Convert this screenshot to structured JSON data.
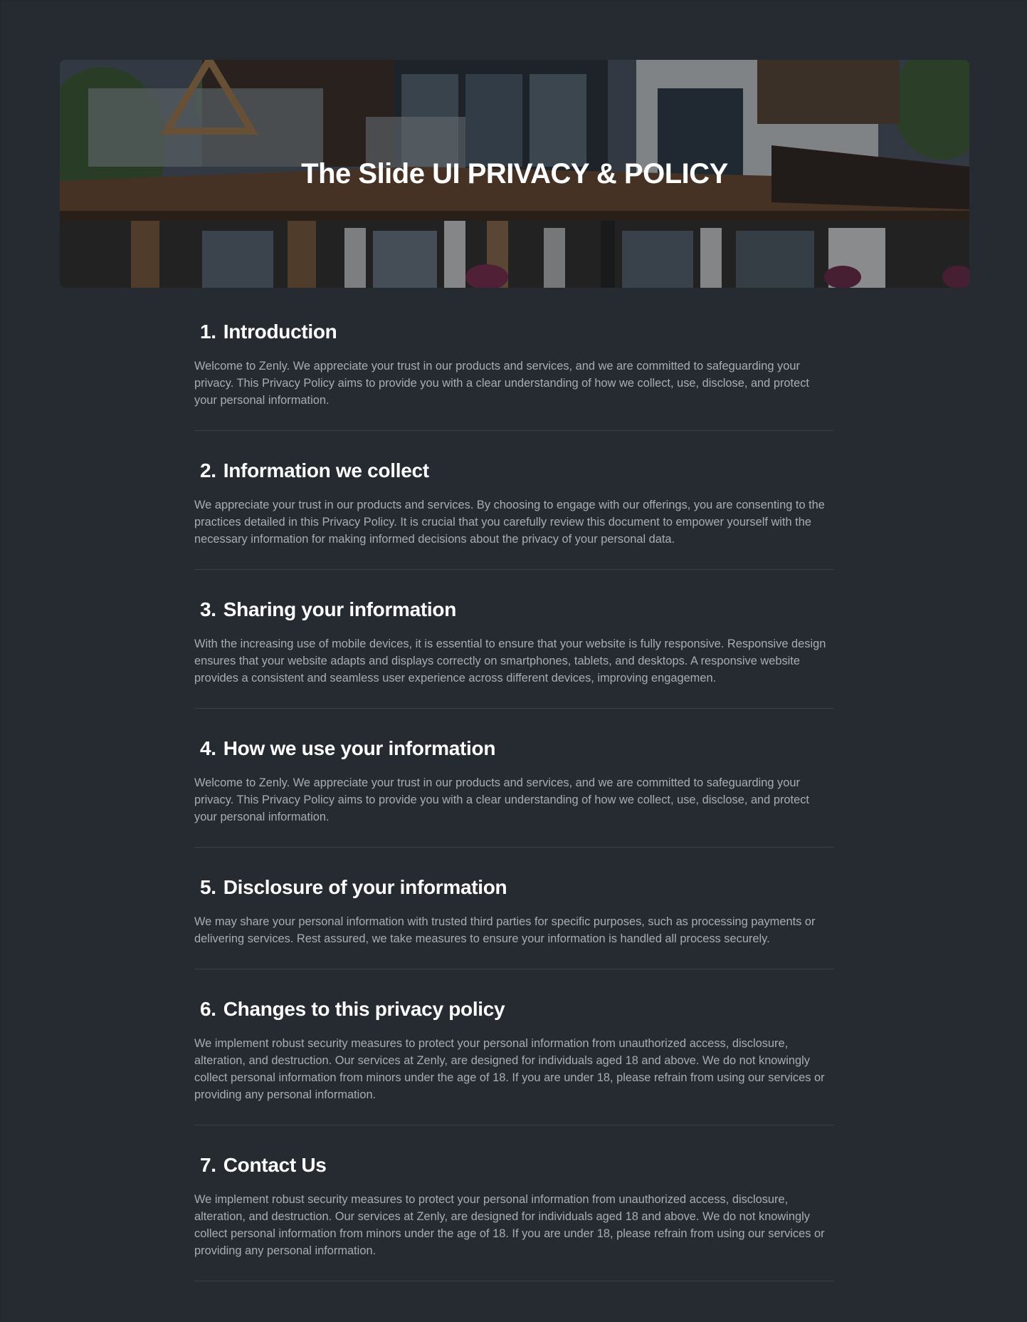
{
  "hero": {
    "title": "The Slide UI PRIVACY & POLICY"
  },
  "colors": {
    "page_background": "#252b30",
    "heading": "#ffffff",
    "body_text": "#a7adb3",
    "divider": "#3a4046"
  },
  "sections": [
    {
      "number": "1.",
      "title": "Introduction",
      "body": "Welcome to Zenly. We appreciate your trust in our products and services, and we are committed to safeguarding your privacy. This Privacy Policy aims to provide you with a clear understanding of how we collect, use, disclose, and protect your personal information."
    },
    {
      "number": "2.",
      "title": "Information we collect",
      "body": "We appreciate your trust in our products and services. By choosing to engage with our offerings, you are consenting to the practices detailed in this Privacy Policy. It is crucial that you carefully review this document to empower yourself with the necessary information for making informed decisions about the privacy of your personal data."
    },
    {
      "number": "3.",
      "title": "Sharing your information",
      "body": "With the increasing use of mobile devices, it is essential to ensure that your website is fully responsive. Responsive design ensures that your website adapts and displays correctly on smartphones, tablets, and desktops. A responsive website provides a consistent and seamless user experience across different devices, improving engagemen."
    },
    {
      "number": "4.",
      "title": "How we use your information",
      "body": "Welcome to Zenly. We appreciate your trust in our products and services, and we are committed to safeguarding your privacy. This Privacy Policy aims to provide you with a clear understanding of how we collect, use, disclose, and protect your personal information."
    },
    {
      "number": "5.",
      "title": "Disclosure of your information",
      "body": "We may share your personal information with trusted third parties for specific purposes, such as processing payments or delivering services. Rest assured, we take measures to ensure your information is handled all process securely."
    },
    {
      "number": "6.",
      "title": "Changes to this privacy policy",
      "body": "We implement robust security measures to protect your personal information from unauthorized access, disclosure, alteration, and destruction. Our services at Zenly, are designed for individuals aged 18 and above. We do not knowingly collect personal information from minors under the age of 18. If you are under 18, please refrain from using our services or providing any personal information."
    },
    {
      "number": "7.",
      "title": "Contact Us",
      "body": "We implement robust security measures to protect your personal information from unauthorized access, disclosure, alteration, and destruction. Our services at Zenly, are designed for individuals aged 18 and above. We do not knowingly collect personal information from minors under the age of 18. If you are under 18, please refrain from using our services or providing any personal information."
    }
  ]
}
